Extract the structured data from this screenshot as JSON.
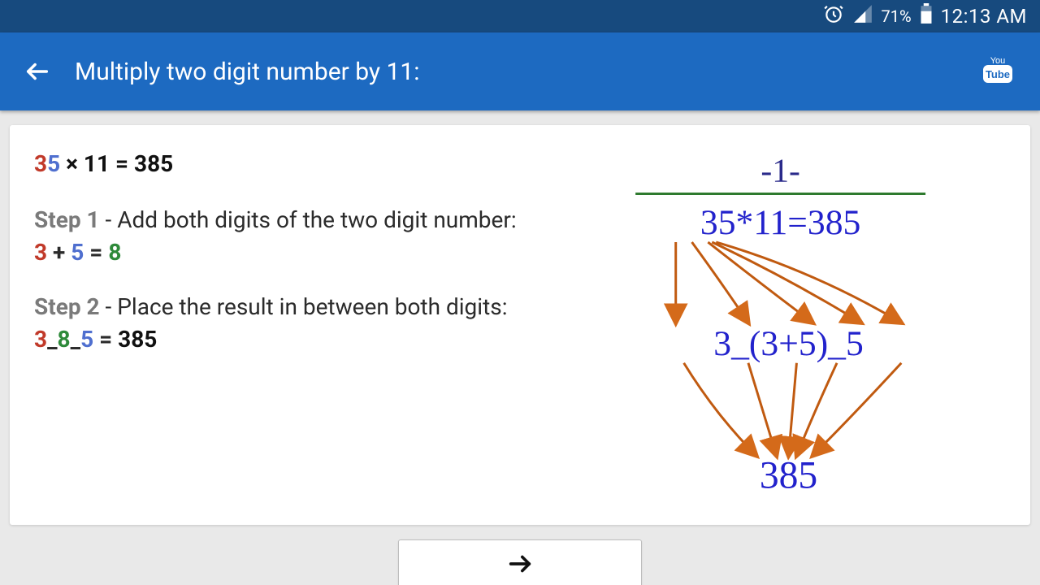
{
  "status": {
    "battery_pct": "71%",
    "time": "12:13 AM"
  },
  "appbar": {
    "title": "Multiply two digit number by 11:"
  },
  "lesson": {
    "equation": {
      "d1": "3",
      "d2": "5",
      "op": " × 11 = ",
      "result": "385"
    },
    "step1": {
      "label": "Step 1",
      "text": " - Add both digits of the two digit number:",
      "calc_a": "3",
      "calc_plus": " + ",
      "calc_b": "5",
      "calc_eq": " = ",
      "calc_r": "8"
    },
    "step2": {
      "label": "Step 2",
      "text": " - Place the result in between both digits:",
      "p1": "3",
      "u1": "_",
      "p2": "8",
      "u2": "_",
      "p3": "5",
      "eq": " = ",
      "result": "385"
    }
  },
  "diagram": {
    "top_fraction": "-1-",
    "line1": "35*11=385",
    "line2": "3_(3+5)_5",
    "line3": "385"
  }
}
